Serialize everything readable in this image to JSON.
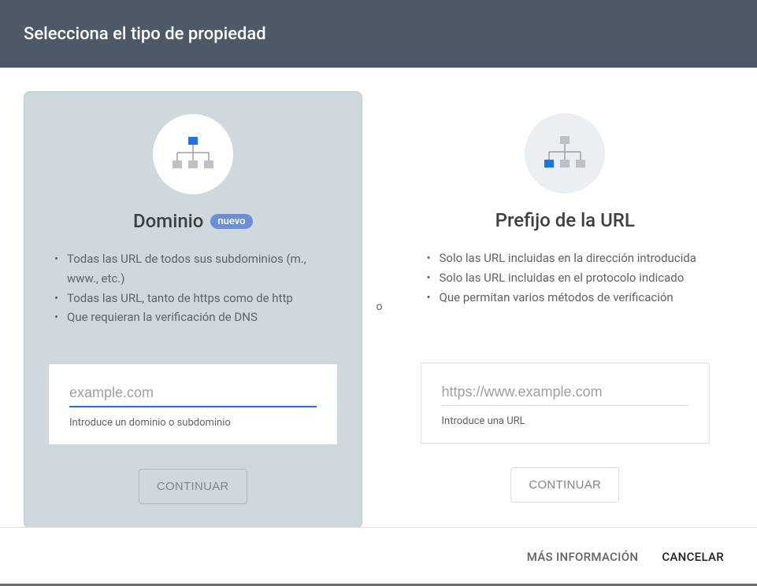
{
  "header": {
    "title": "Selecciona el tipo de propiedad"
  },
  "divider": "o",
  "domain_card": {
    "title": "Dominio",
    "badge": "nuevo",
    "bullets": [
      "Todas las URL de todos sus subdominios (m., www., etc.)",
      "Todas las URL, tanto de https como de http",
      "Que requieran la verificación de DNS"
    ],
    "input_placeholder": "example.com",
    "input_value": "",
    "input_helper": "Introduce un dominio o subdominio",
    "continue": "CONTINUAR"
  },
  "url_card": {
    "title": "Prefijo de la URL",
    "bullets": [
      "Solo las URL incluidas en la dirección introducida",
      "Solo las URL incluidas en el protocolo indicado",
      "Que permitan varios métodos de verificación"
    ],
    "input_placeholder": "https://www.example.com",
    "input_value": "",
    "input_helper": "Introduce una URL",
    "continue": "CONTINUAR"
  },
  "footer": {
    "more_info": "MÁS INFORMACIÓN",
    "cancel": "CANCELAR"
  }
}
